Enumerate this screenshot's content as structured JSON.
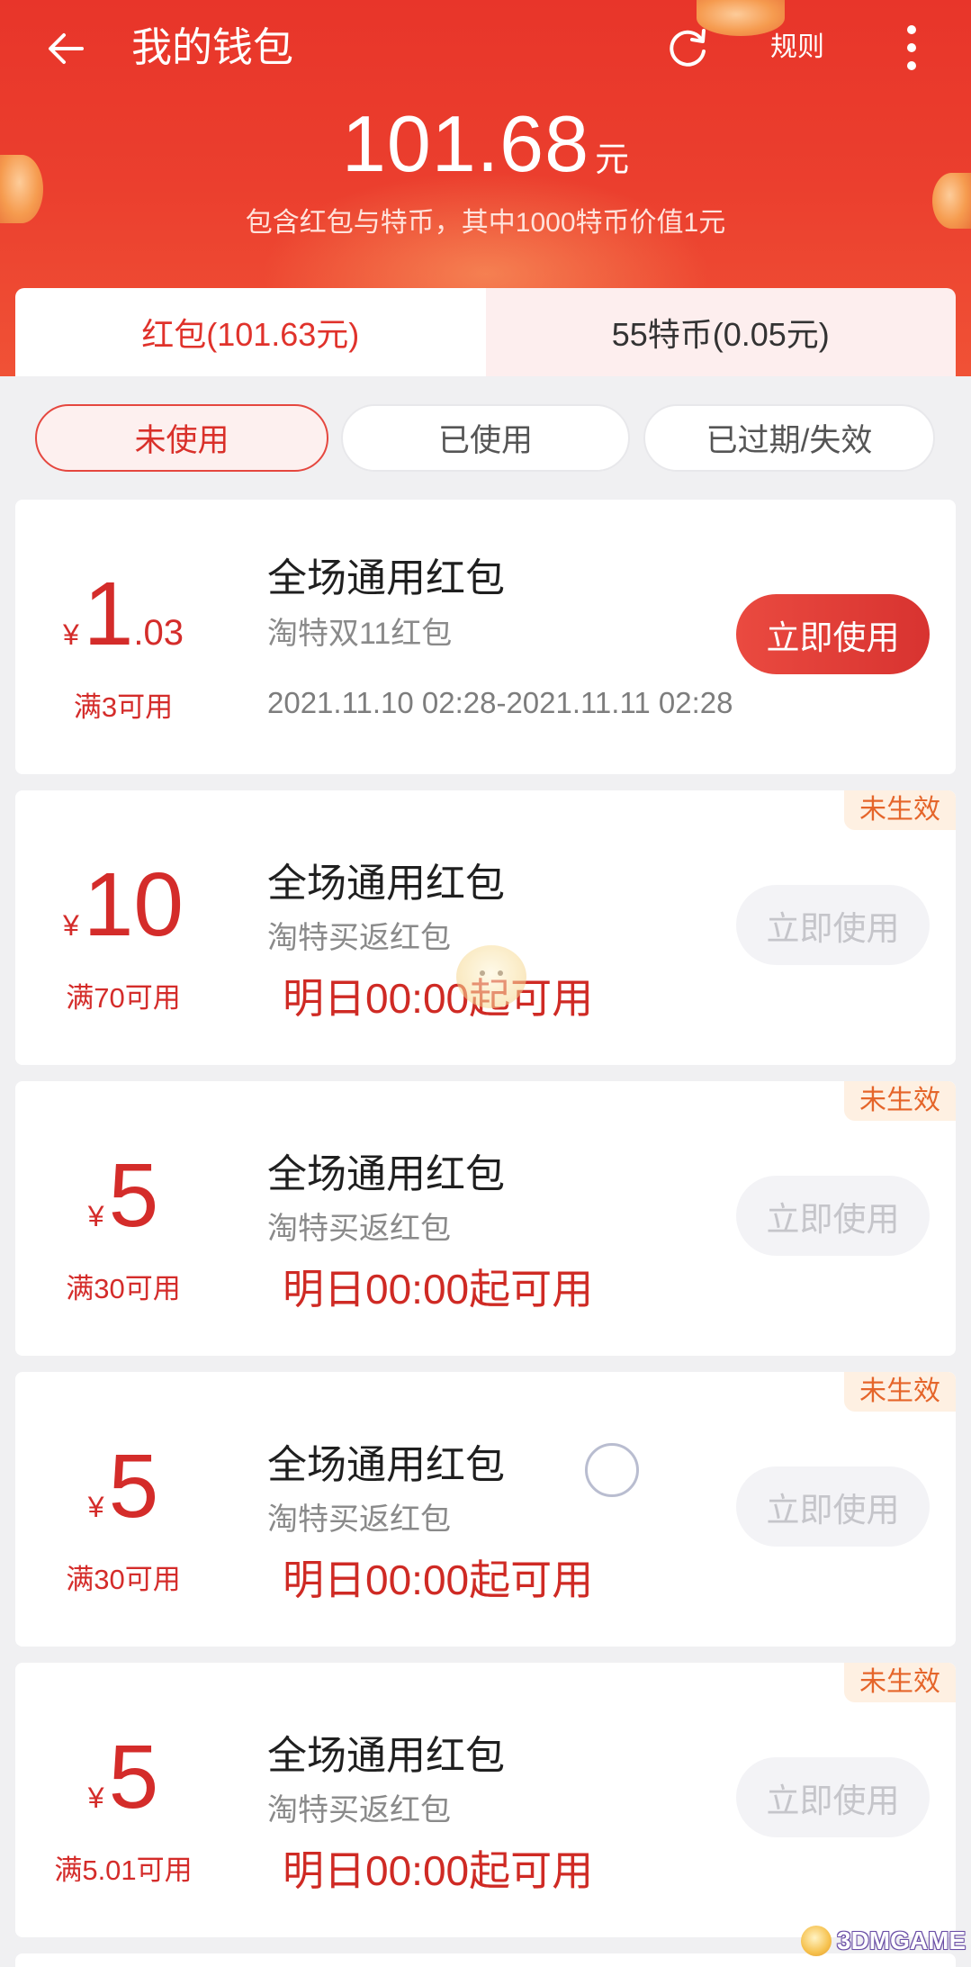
{
  "header": {
    "title": "我的钱包",
    "rules_label": "规则",
    "balance_amount": "101.68",
    "balance_unit": "元",
    "balance_note": "包含红包与特币，其中1000特币价值1元"
  },
  "icons": {
    "back": "back-arrow-icon",
    "refresh": "refresh-icon",
    "more": "more-vertical-icon"
  },
  "tabs": [
    {
      "label": "红包(101.63元)",
      "active": true
    },
    {
      "label": "55特币(0.05元)",
      "active": false
    }
  ],
  "filters": [
    {
      "label": "未使用",
      "active": true
    },
    {
      "label": "已使用",
      "active": false
    },
    {
      "label": "已过期/失效",
      "active": false
    }
  ],
  "coupons": [
    {
      "currency": "¥",
      "amount_int": "1",
      "amount_dec": ".03",
      "condition": "满3可用",
      "title": "全场通用红包",
      "subtitle": "淘特双11红包",
      "validity": "2021.11.10 02:28-2021.11.11 02:28",
      "button_label": "立即使用",
      "enabled": true
    },
    {
      "status": "未生效",
      "currency": "¥",
      "amount_int": "10",
      "condition": "满70可用",
      "title": "全场通用红包",
      "subtitle": "淘特买返红包",
      "start_notice": "明日00:00起可用",
      "button_label": "立即使用",
      "enabled": false
    },
    {
      "status": "未生效",
      "currency": "¥",
      "amount_int": "5",
      "condition": "满30可用",
      "title": "全场通用红包",
      "subtitle": "淘特买返红包",
      "start_notice": "明日00:00起可用",
      "button_label": "立即使用",
      "enabled": false
    },
    {
      "status": "未生效",
      "currency": "¥",
      "amount_int": "5",
      "condition": "满30可用",
      "title": "全场通用红包",
      "subtitle": "淘特买返红包",
      "start_notice": "明日00:00起可用",
      "button_label": "立即使用",
      "enabled": false
    },
    {
      "status": "未生效",
      "currency": "¥",
      "amount_int": "5",
      "condition": "满5.01可用",
      "title": "全场通用红包",
      "subtitle": "淘特买返红包",
      "start_notice": "明日00:00起可用",
      "button_label": "立即使用",
      "enabled": false
    }
  ],
  "watermark": {
    "text": "3DMGAME"
  },
  "colors": {
    "header_red": "#e8352a",
    "accent_red": "#d42c2a",
    "active_tab_text": "#e0322b",
    "inactive_tab_bg": "#fdeeee",
    "badge_text": "#e5652a",
    "badge_bg": "#fef0e2",
    "button_disabled_bg": "#f3f3f6",
    "page_bg": "#f0f0f2"
  }
}
